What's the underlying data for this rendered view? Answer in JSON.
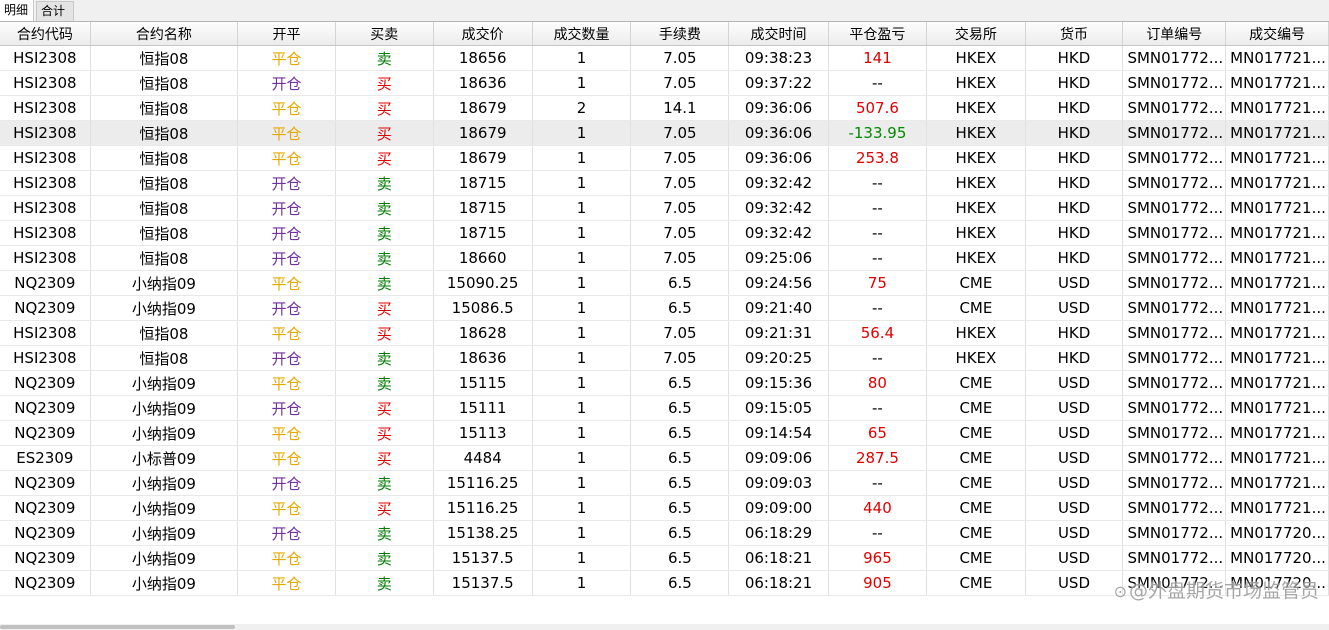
{
  "tabs": [
    {
      "label": "明细",
      "active": true
    },
    {
      "label": "合计",
      "active": false
    }
  ],
  "columns": [
    "合约代码",
    "合约名称",
    "开平",
    "买卖",
    "成交价",
    "成交数量",
    "手续费",
    "成交时间",
    "平仓盈亏",
    "交易所",
    "货币",
    "订单编号",
    "成交编号"
  ],
  "rows": [
    [
      "HSI2308",
      "恒指08",
      "平仓",
      "卖",
      "18656",
      "1",
      "7.05",
      "09:38:23",
      "141",
      "HKEX",
      "HKD",
      "SMN01772...",
      "MN017721..."
    ],
    [
      "HSI2308",
      "恒指08",
      "开仓",
      "买",
      "18636",
      "1",
      "7.05",
      "09:37:22",
      "--",
      "HKEX",
      "HKD",
      "SMN01772...",
      "MN017721..."
    ],
    [
      "HSI2308",
      "恒指08",
      "平仓",
      "买",
      "18679",
      "2",
      "14.1",
      "09:36:06",
      "507.6",
      "HKEX",
      "HKD",
      "SMN01772...",
      "MN017721..."
    ],
    [
      "HSI2308",
      "恒指08",
      "平仓",
      "买",
      "18679",
      "1",
      "7.05",
      "09:36:06",
      "-133.95",
      "HKEX",
      "HKD",
      "SMN01772...",
      "MN017721..."
    ],
    [
      "HSI2308",
      "恒指08",
      "平仓",
      "买",
      "18679",
      "1",
      "7.05",
      "09:36:06",
      "253.8",
      "HKEX",
      "HKD",
      "SMN01772...",
      "MN017721..."
    ],
    [
      "HSI2308",
      "恒指08",
      "开仓",
      "卖",
      "18715",
      "1",
      "7.05",
      "09:32:42",
      "--",
      "HKEX",
      "HKD",
      "SMN01772...",
      "MN017721..."
    ],
    [
      "HSI2308",
      "恒指08",
      "开仓",
      "卖",
      "18715",
      "1",
      "7.05",
      "09:32:42",
      "--",
      "HKEX",
      "HKD",
      "SMN01772...",
      "MN017721..."
    ],
    [
      "HSI2308",
      "恒指08",
      "开仓",
      "卖",
      "18715",
      "1",
      "7.05",
      "09:32:42",
      "--",
      "HKEX",
      "HKD",
      "SMN01772...",
      "MN017721..."
    ],
    [
      "HSI2308",
      "恒指08",
      "开仓",
      "卖",
      "18660",
      "1",
      "7.05",
      "09:25:06",
      "--",
      "HKEX",
      "HKD",
      "SMN01772...",
      "MN017721..."
    ],
    [
      "NQ2309",
      "小纳指09",
      "平仓",
      "卖",
      "15090.25",
      "1",
      "6.5",
      "09:24:56",
      "75",
      "CME",
      "USD",
      "SMN01772...",
      "MN017721..."
    ],
    [
      "NQ2309",
      "小纳指09",
      "开仓",
      "买",
      "15086.5",
      "1",
      "6.5",
      "09:21:40",
      "--",
      "CME",
      "USD",
      "SMN01772...",
      "MN017721..."
    ],
    [
      "HSI2308",
      "恒指08",
      "平仓",
      "买",
      "18628",
      "1",
      "7.05",
      "09:21:31",
      "56.4",
      "HKEX",
      "HKD",
      "SMN01772...",
      "MN017721..."
    ],
    [
      "HSI2308",
      "恒指08",
      "开仓",
      "卖",
      "18636",
      "1",
      "7.05",
      "09:20:25",
      "--",
      "HKEX",
      "HKD",
      "SMN01772...",
      "MN017721..."
    ],
    [
      "NQ2309",
      "小纳指09",
      "平仓",
      "卖",
      "15115",
      "1",
      "6.5",
      "09:15:36",
      "80",
      "CME",
      "USD",
      "SMN01772...",
      "MN017721..."
    ],
    [
      "NQ2309",
      "小纳指09",
      "开仓",
      "买",
      "15111",
      "1",
      "6.5",
      "09:15:05",
      "--",
      "CME",
      "USD",
      "SMN01772...",
      "MN017721..."
    ],
    [
      "NQ2309",
      "小纳指09",
      "平仓",
      "买",
      "15113",
      "1",
      "6.5",
      "09:14:54",
      "65",
      "CME",
      "USD",
      "SMN01772...",
      "MN017721..."
    ],
    [
      "ES2309",
      "小标普09",
      "平仓",
      "买",
      "4484",
      "1",
      "6.5",
      "09:09:06",
      "287.5",
      "CME",
      "USD",
      "SMN01772...",
      "MN017721..."
    ],
    [
      "NQ2309",
      "小纳指09",
      "开仓",
      "卖",
      "15116.25",
      "1",
      "6.5",
      "09:09:03",
      "--",
      "CME",
      "USD",
      "SMN01772...",
      "MN017721..."
    ],
    [
      "NQ2309",
      "小纳指09",
      "平仓",
      "买",
      "15116.25",
      "1",
      "6.5",
      "09:09:00",
      "440",
      "CME",
      "USD",
      "SMN01772...",
      "MN017721..."
    ],
    [
      "NQ2309",
      "小纳指09",
      "开仓",
      "卖",
      "15138.25",
      "1",
      "6.5",
      "06:18:29",
      "--",
      "CME",
      "USD",
      "SMN01772...",
      "MN017720..."
    ],
    [
      "NQ2309",
      "小纳指09",
      "平仓",
      "卖",
      "15137.5",
      "1",
      "6.5",
      "06:18:21",
      "965",
      "CME",
      "USD",
      "SMN01772...",
      "MN017720..."
    ],
    [
      "NQ2309",
      "小纳指09",
      "平仓",
      "卖",
      "15137.5",
      "1",
      "6.5",
      "06:18:21",
      "905",
      "CME",
      "USD",
      "SMN01772...",
      "MN017720..."
    ]
  ],
  "selected_row": 3,
  "watermark": "@外盘期货市场监管员",
  "colors": {
    "open": "#7030a0",
    "close": "#e6a800",
    "buy": "#e00000",
    "sell": "#007a00",
    "profit": "#e00000",
    "loss": "#008a00"
  }
}
